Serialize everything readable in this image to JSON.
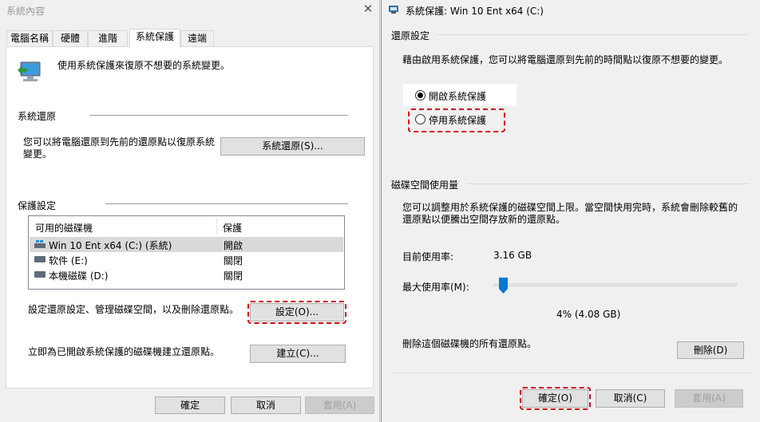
{
  "left_window": {
    "title": "系統內容",
    "tabs": [
      {
        "label": "電腦名稱"
      },
      {
        "label": "硬體"
      },
      {
        "label": "進階"
      },
      {
        "label": "系統保護"
      },
      {
        "label": "遠端"
      }
    ],
    "intro_text": "使用系統保護來復原不想要的系統變更。",
    "restore_section": {
      "heading": "系統還原",
      "description_line1": "您可以將電腦還原到先前的還原點以復原系統",
      "description_line2": "變更。",
      "button": "系統還原(S)..."
    },
    "protection_section": {
      "heading": "保護設定",
      "columns": [
        "可用的磁碟機",
        "保護"
      ],
      "drives": [
        {
          "name": "Win 10 Ent x64 (C:) (系統)",
          "protection": "開啟"
        },
        {
          "name": "软件 (E:)",
          "protection": "關閉"
        },
        {
          "name": "本機磁碟 (D:)",
          "protection": "關閉"
        }
      ],
      "configure_text": "設定還原設定、管理磁碟空間，以及刪除還原點。",
      "configure_button": "設定(O)...",
      "create_text": "立即為已開啟系統保護的磁碟機建立還原點。",
      "create_button": "建立(C)..."
    },
    "footer": {
      "ok": "確定",
      "cancel": "取消",
      "apply": "套用(A)"
    }
  },
  "right_window": {
    "title": "系統保護: Win 10 Ent x64 (C:)",
    "restore_settings": {
      "heading": "還原設定",
      "description": "藉由啟用系統保護，您可以將電腦還原到先前的時間點以復原不想要的變更。",
      "option_on": "開啟系統保護",
      "option_off": "停用系統保護",
      "selected": "on"
    },
    "disk_usage": {
      "heading": "磁碟空間使用量",
      "description_line1": "您可以調整用於系統保護的磁碟空間上限。當空間快用完時，系統會刪除較舊的",
      "description_line2": "還原點以便騰出空間存放新的還原點。",
      "current_label": "目前使用率:",
      "current_value": "3.16 GB",
      "max_label": "最大使用率(M):",
      "max_value_text": "4% (4.08 GB)",
      "max_percent": 4,
      "delete_text": "刪除這個磁碟機的所有還原點。",
      "delete_button": "刪除(D)"
    },
    "footer": {
      "ok": "確定(O)",
      "cancel": "取消(C)",
      "apply": "套用(A)"
    }
  },
  "colors": {
    "highlight_dash": "#d9000d",
    "slider_accent": "#0078d7"
  }
}
